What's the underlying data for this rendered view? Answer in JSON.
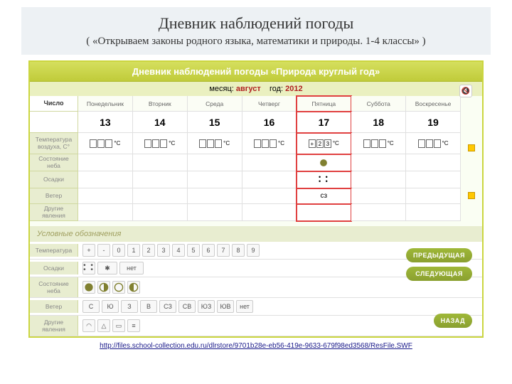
{
  "slide": {
    "title_main": "Дневник наблюдений погоды",
    "title_sub": "( «Открываем законы родного языка, математики и природы. 1-4 классы» )"
  },
  "app": {
    "header": "Дневник наблюдений погоды «Природа круглый год»",
    "month_label": "месяц:",
    "month_value": "август",
    "year_label": "год:",
    "year_value": "2012",
    "row_labels": [
      "Число",
      "Температура воздуха, С°",
      "Состояние неба",
      "Осадки",
      "Ветер",
      "Другие явления"
    ],
    "day_names": [
      "Понедельник",
      "Вторник",
      "Среда",
      "Четверг",
      "Пятница",
      "Суббота",
      "Воскресенье"
    ],
    "day_nums": [
      "13",
      "14",
      "15",
      "16",
      "17",
      "18",
      "19"
    ],
    "selected_col": 4,
    "selected_temp": [
      "+",
      "2",
      "3"
    ],
    "deg": "°C",
    "wind_sel": "сз",
    "legend_title": "Условные обозначения",
    "legend": {
      "temp": {
        "label": "Температура",
        "items": [
          "+",
          "-",
          "0",
          "1",
          "2",
          "3",
          "4",
          "5",
          "6",
          "7",
          "8",
          "9"
        ]
      },
      "precip": {
        "label": "Осадки",
        "none": "нет"
      },
      "sky": {
        "label": "Состояние неба"
      },
      "wind": {
        "label": "Ветер",
        "items": [
          "С",
          "Ю",
          "З",
          "В",
          "СЗ",
          "СВ",
          "ЮЗ",
          "ЮВ",
          "нет"
        ]
      },
      "other": {
        "label": "Другие явления"
      }
    },
    "buttons": {
      "prev": "ПРЕДЫДУЩАЯ",
      "next": "СЛЕДУЮЩАЯ",
      "back": "НАЗАД"
    }
  },
  "link": {
    "url": "http://files.school-collection.edu.ru/dlrstore/9701b28e-eb56-419e-9633-679f98ed3568/ResFile.SWF"
  }
}
